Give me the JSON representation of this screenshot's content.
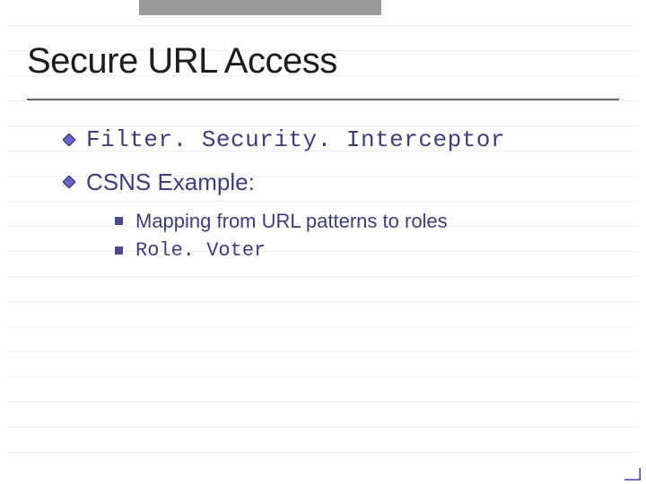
{
  "slide": {
    "title": "Secure URL Access",
    "bullets": [
      {
        "text": "Filter. Security. Interceptor",
        "style": "mono"
      },
      {
        "text": "CSNS Example:",
        "style": "normal"
      }
    ],
    "subbullets": [
      {
        "text": "Mapping from URL patterns to roles",
        "style": "normal"
      },
      {
        "text": "Role. Voter",
        "style": "mono"
      }
    ]
  },
  "colors": {
    "accent": "#3f3e7a",
    "bullet": "#4a4a8a",
    "topbar": "#9b9b9b",
    "rule": "#656565"
  }
}
